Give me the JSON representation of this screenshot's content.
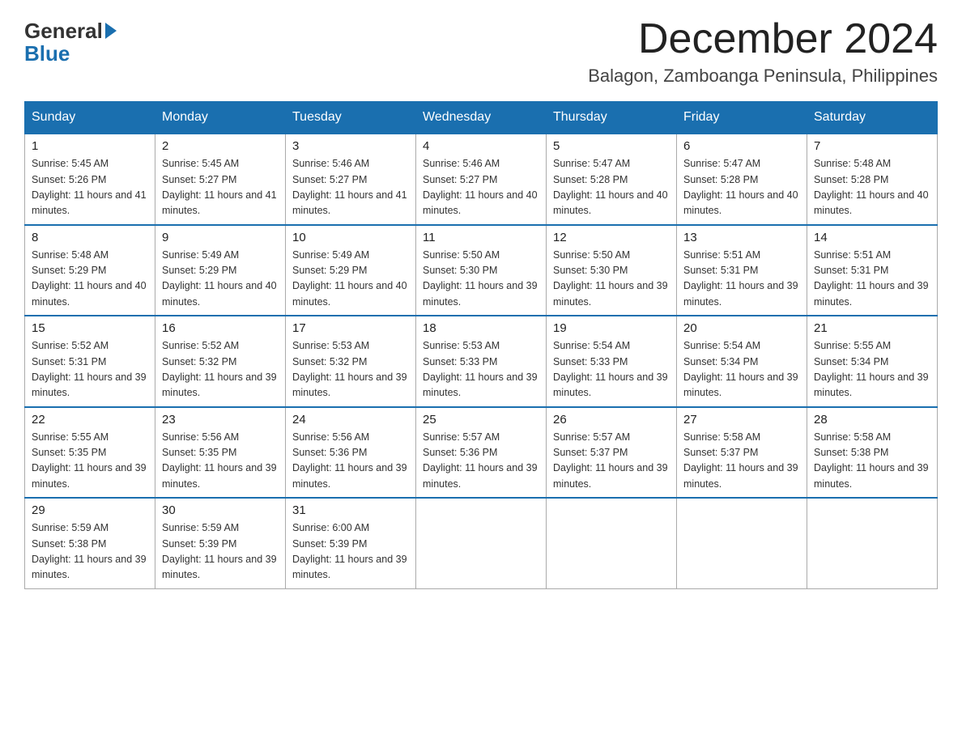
{
  "header": {
    "logo_general": "General",
    "logo_blue": "Blue",
    "month_title": "December 2024",
    "location": "Balagon, Zamboanga Peninsula, Philippines"
  },
  "weekdays": [
    "Sunday",
    "Monday",
    "Tuesday",
    "Wednesday",
    "Thursday",
    "Friday",
    "Saturday"
  ],
  "weeks": [
    [
      {
        "day": "1",
        "sunrise": "Sunrise: 5:45 AM",
        "sunset": "Sunset: 5:26 PM",
        "daylight": "Daylight: 11 hours and 41 minutes."
      },
      {
        "day": "2",
        "sunrise": "Sunrise: 5:45 AM",
        "sunset": "Sunset: 5:27 PM",
        "daylight": "Daylight: 11 hours and 41 minutes."
      },
      {
        "day": "3",
        "sunrise": "Sunrise: 5:46 AM",
        "sunset": "Sunset: 5:27 PM",
        "daylight": "Daylight: 11 hours and 41 minutes."
      },
      {
        "day": "4",
        "sunrise": "Sunrise: 5:46 AM",
        "sunset": "Sunset: 5:27 PM",
        "daylight": "Daylight: 11 hours and 40 minutes."
      },
      {
        "day": "5",
        "sunrise": "Sunrise: 5:47 AM",
        "sunset": "Sunset: 5:28 PM",
        "daylight": "Daylight: 11 hours and 40 minutes."
      },
      {
        "day": "6",
        "sunrise": "Sunrise: 5:47 AM",
        "sunset": "Sunset: 5:28 PM",
        "daylight": "Daylight: 11 hours and 40 minutes."
      },
      {
        "day": "7",
        "sunrise": "Sunrise: 5:48 AM",
        "sunset": "Sunset: 5:28 PM",
        "daylight": "Daylight: 11 hours and 40 minutes."
      }
    ],
    [
      {
        "day": "8",
        "sunrise": "Sunrise: 5:48 AM",
        "sunset": "Sunset: 5:29 PM",
        "daylight": "Daylight: 11 hours and 40 minutes."
      },
      {
        "day": "9",
        "sunrise": "Sunrise: 5:49 AM",
        "sunset": "Sunset: 5:29 PM",
        "daylight": "Daylight: 11 hours and 40 minutes."
      },
      {
        "day": "10",
        "sunrise": "Sunrise: 5:49 AM",
        "sunset": "Sunset: 5:29 PM",
        "daylight": "Daylight: 11 hours and 40 minutes."
      },
      {
        "day": "11",
        "sunrise": "Sunrise: 5:50 AM",
        "sunset": "Sunset: 5:30 PM",
        "daylight": "Daylight: 11 hours and 39 minutes."
      },
      {
        "day": "12",
        "sunrise": "Sunrise: 5:50 AM",
        "sunset": "Sunset: 5:30 PM",
        "daylight": "Daylight: 11 hours and 39 minutes."
      },
      {
        "day": "13",
        "sunrise": "Sunrise: 5:51 AM",
        "sunset": "Sunset: 5:31 PM",
        "daylight": "Daylight: 11 hours and 39 minutes."
      },
      {
        "day": "14",
        "sunrise": "Sunrise: 5:51 AM",
        "sunset": "Sunset: 5:31 PM",
        "daylight": "Daylight: 11 hours and 39 minutes."
      }
    ],
    [
      {
        "day": "15",
        "sunrise": "Sunrise: 5:52 AM",
        "sunset": "Sunset: 5:31 PM",
        "daylight": "Daylight: 11 hours and 39 minutes."
      },
      {
        "day": "16",
        "sunrise": "Sunrise: 5:52 AM",
        "sunset": "Sunset: 5:32 PM",
        "daylight": "Daylight: 11 hours and 39 minutes."
      },
      {
        "day": "17",
        "sunrise": "Sunrise: 5:53 AM",
        "sunset": "Sunset: 5:32 PM",
        "daylight": "Daylight: 11 hours and 39 minutes."
      },
      {
        "day": "18",
        "sunrise": "Sunrise: 5:53 AM",
        "sunset": "Sunset: 5:33 PM",
        "daylight": "Daylight: 11 hours and 39 minutes."
      },
      {
        "day": "19",
        "sunrise": "Sunrise: 5:54 AM",
        "sunset": "Sunset: 5:33 PM",
        "daylight": "Daylight: 11 hours and 39 minutes."
      },
      {
        "day": "20",
        "sunrise": "Sunrise: 5:54 AM",
        "sunset": "Sunset: 5:34 PM",
        "daylight": "Daylight: 11 hours and 39 minutes."
      },
      {
        "day": "21",
        "sunrise": "Sunrise: 5:55 AM",
        "sunset": "Sunset: 5:34 PM",
        "daylight": "Daylight: 11 hours and 39 minutes."
      }
    ],
    [
      {
        "day": "22",
        "sunrise": "Sunrise: 5:55 AM",
        "sunset": "Sunset: 5:35 PM",
        "daylight": "Daylight: 11 hours and 39 minutes."
      },
      {
        "day": "23",
        "sunrise": "Sunrise: 5:56 AM",
        "sunset": "Sunset: 5:35 PM",
        "daylight": "Daylight: 11 hours and 39 minutes."
      },
      {
        "day": "24",
        "sunrise": "Sunrise: 5:56 AM",
        "sunset": "Sunset: 5:36 PM",
        "daylight": "Daylight: 11 hours and 39 minutes."
      },
      {
        "day": "25",
        "sunrise": "Sunrise: 5:57 AM",
        "sunset": "Sunset: 5:36 PM",
        "daylight": "Daylight: 11 hours and 39 minutes."
      },
      {
        "day": "26",
        "sunrise": "Sunrise: 5:57 AM",
        "sunset": "Sunset: 5:37 PM",
        "daylight": "Daylight: 11 hours and 39 minutes."
      },
      {
        "day": "27",
        "sunrise": "Sunrise: 5:58 AM",
        "sunset": "Sunset: 5:37 PM",
        "daylight": "Daylight: 11 hours and 39 minutes."
      },
      {
        "day": "28",
        "sunrise": "Sunrise: 5:58 AM",
        "sunset": "Sunset: 5:38 PM",
        "daylight": "Daylight: 11 hours and 39 minutes."
      }
    ],
    [
      {
        "day": "29",
        "sunrise": "Sunrise: 5:59 AM",
        "sunset": "Sunset: 5:38 PM",
        "daylight": "Daylight: 11 hours and 39 minutes."
      },
      {
        "day": "30",
        "sunrise": "Sunrise: 5:59 AM",
        "sunset": "Sunset: 5:39 PM",
        "daylight": "Daylight: 11 hours and 39 minutes."
      },
      {
        "day": "31",
        "sunrise": "Sunrise: 6:00 AM",
        "sunset": "Sunset: 5:39 PM",
        "daylight": "Daylight: 11 hours and 39 minutes."
      },
      null,
      null,
      null,
      null
    ]
  ]
}
